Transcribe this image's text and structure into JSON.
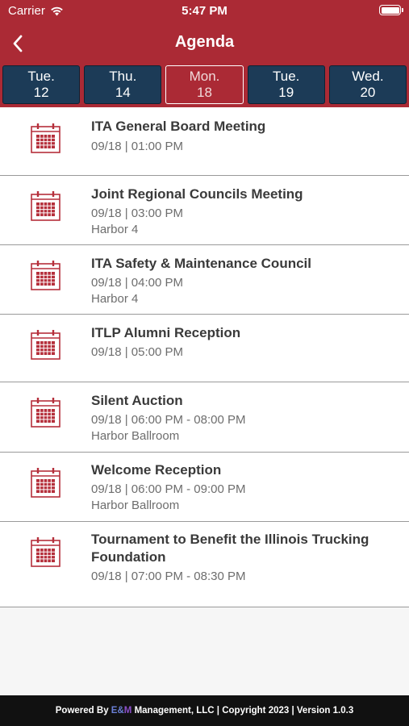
{
  "status_bar": {
    "carrier": "Carrier",
    "time": "5:47 PM"
  },
  "nav": {
    "title": "Agenda"
  },
  "date_tabs": [
    {
      "dow": "Tue.",
      "day": "12",
      "active": false
    },
    {
      "dow": "Thu.",
      "day": "14",
      "active": false
    },
    {
      "dow": "Mon.",
      "day": "18",
      "active": true
    },
    {
      "dow": "Tue.",
      "day": "19",
      "active": false
    },
    {
      "dow": "Wed.",
      "day": "20",
      "active": false
    }
  ],
  "events": [
    {
      "title": "ITA General Board Meeting",
      "time": "09/18 | 01:00 PM",
      "location": ""
    },
    {
      "title": "Joint Regional Councils Meeting",
      "time": "09/18 | 03:00 PM",
      "location": "Harbor 4"
    },
    {
      "title": "ITA Safety & Maintenance Council",
      "time": "09/18 | 04:00 PM",
      "location": "Harbor 4"
    },
    {
      "title": "ITLP Alumni Reception",
      "time": "09/18 | 05:00 PM",
      "location": ""
    },
    {
      "title": "Silent Auction",
      "time": "09/18 | 06:00 PM - 08:00 PM",
      "location": "Harbor Ballroom"
    },
    {
      "title": "Welcome Reception",
      "time": "09/18 | 06:00 PM - 09:00 PM",
      "location": "Harbor Ballroom"
    },
    {
      "title": "Tournament to Benefit the Illinois Trucking Foundation",
      "time": "09/18 | 07:00 PM - 08:30 PM",
      "location": ""
    }
  ],
  "footer": {
    "prefix": "Powered By ",
    "brand_e": "E&",
    "brand_m": "M",
    "suffix": " Management, LLC | Copyright 2023 | Version 1.0.3"
  },
  "colors": {
    "brand_red": "#ab2a35",
    "tab_navy": "#1c3b57",
    "icon_red": "#b52f3b"
  }
}
